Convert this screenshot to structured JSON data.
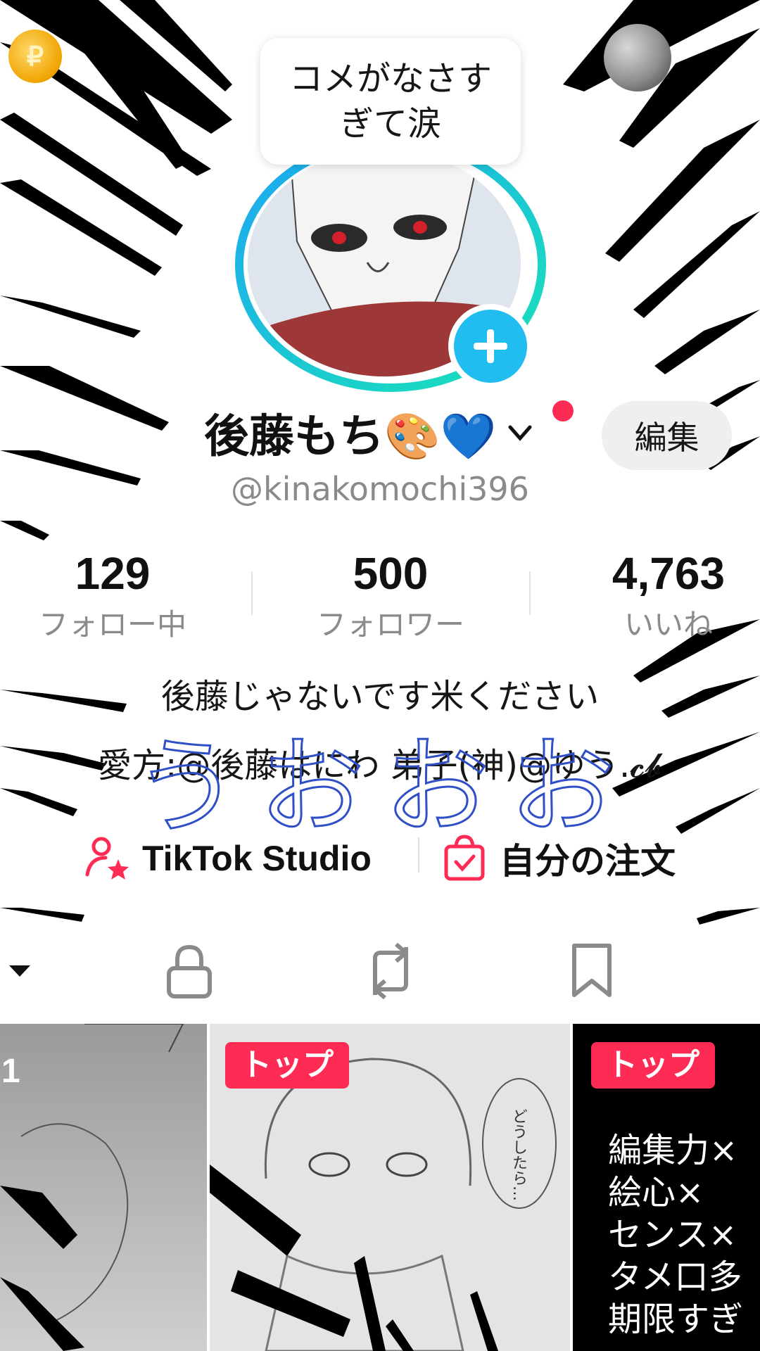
{
  "tooltip": {
    "text": "コメがなさすぎて涙"
  },
  "profile": {
    "display_name": "後藤もち🎨💙",
    "username": "@kinakomochi396",
    "edit_label": "編集"
  },
  "stats": [
    {
      "value": "129",
      "label": "フォロー中"
    },
    {
      "value": "500",
      "label": "フォロワー"
    },
    {
      "value": "4,763",
      "label": "いいね"
    }
  ],
  "bio": {
    "line1": "後藤じゃないです米ください",
    "line2": "愛方:@後藤はにわ  弟子(神)@ゆう.𝓬𝓫"
  },
  "overlay_handwriting": "うおおお",
  "links": {
    "studio_label": "TikTok Studio",
    "orders_label": "自分の注文"
  },
  "tabs": [
    {
      "icon": "dropdown-caret-icon"
    },
    {
      "icon": "lock-icon"
    },
    {
      "icon": "repost-icon"
    },
    {
      "icon": "bookmark-icon"
    }
  ],
  "videos": [
    {
      "pin_number": "1",
      "tag": ""
    },
    {
      "pin_number": "",
      "tag": "トップ",
      "speech": "どうしたら…"
    },
    {
      "pin_number": "",
      "tag": "トップ",
      "lines": [
        "編集力×",
        "絵心×",
        "センス×",
        "タメ口多",
        "期限すぎ"
      ]
    }
  ],
  "colors": {
    "accent": "#fe2c55",
    "plus_button": "#21bdf0",
    "ring_start": "#1da7f2",
    "ring_end": "#19e3b8"
  }
}
